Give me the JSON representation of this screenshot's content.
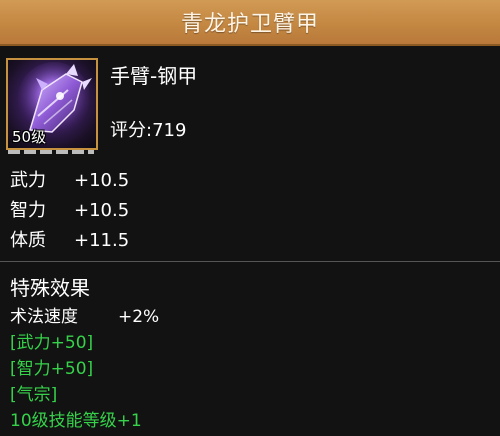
{
  "title": "青龙护卫臂甲",
  "item": {
    "type": "手臂-钢甲",
    "score": "评分:719",
    "level": "50级",
    "icon": "purple-armguard-icon"
  },
  "stats": [
    {
      "name": "武力",
      "value": "+10.5"
    },
    {
      "name": "智力",
      "value": "+10.5"
    },
    {
      "name": "体质",
      "value": "+11.5"
    }
  ],
  "effects": {
    "title": "特殊效果",
    "speed": {
      "name": "术法速度",
      "value": "+2%"
    },
    "green_lines": [
      "[武力+50]",
      "[智力+50]",
      "[气宗]",
      "10级技能等级+1"
    ]
  },
  "colors": {
    "title_bar": "#c48842",
    "item_frame": "#c7923f",
    "effect_green": "#35d24a",
    "background": "#121212"
  }
}
